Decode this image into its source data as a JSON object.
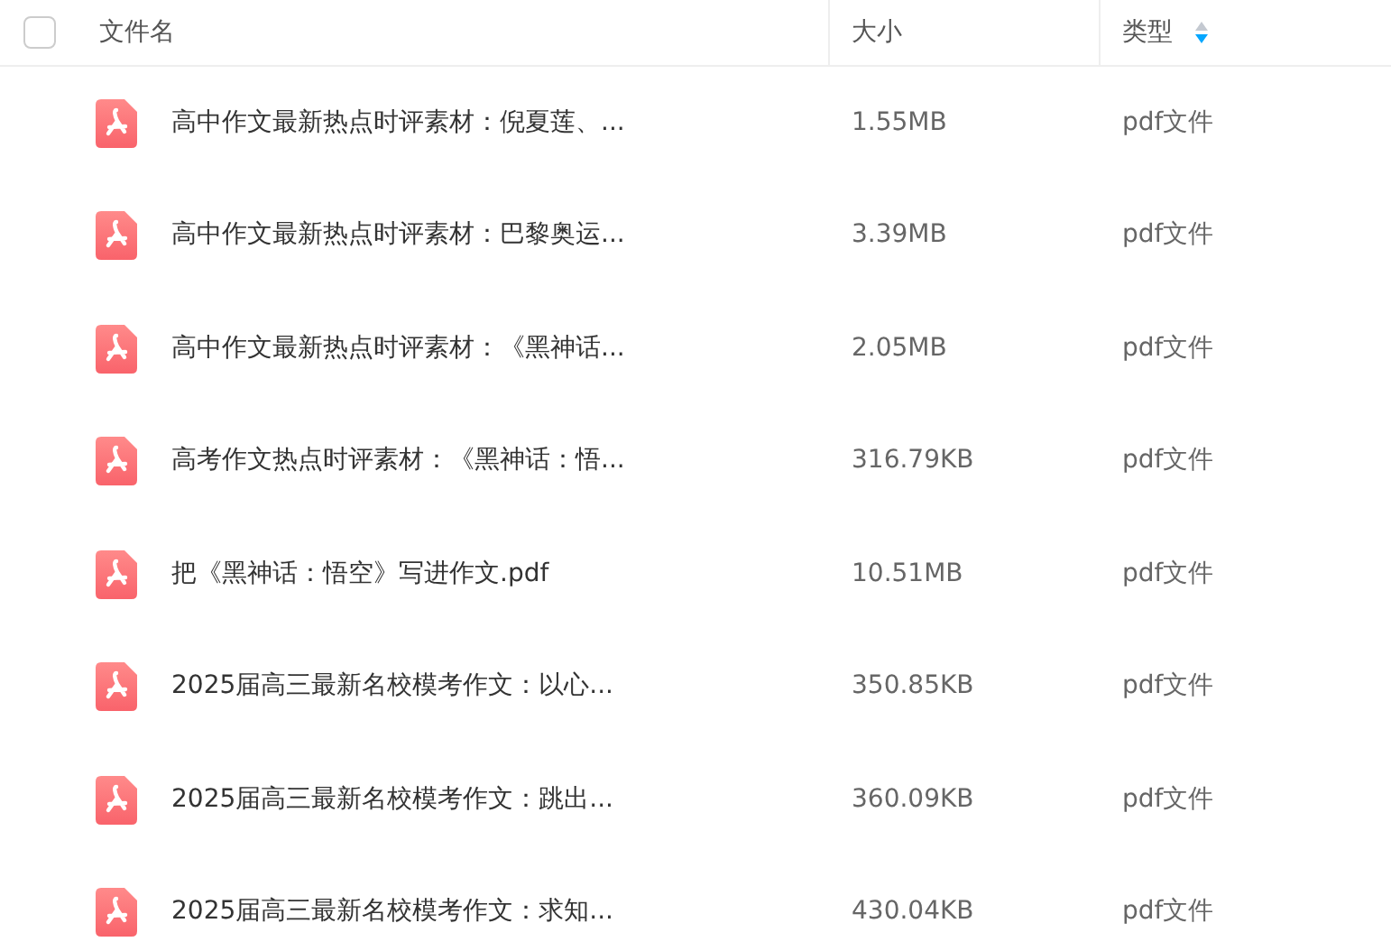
{
  "header": {
    "select_all": {
      "checked": false
    },
    "columns": [
      {
        "label": "文件名"
      },
      {
        "label": "大小"
      },
      {
        "label": "类型",
        "sort_descending": true
      }
    ]
  },
  "files": [
    {
      "name": "高中作文最新热点时评素材：倪夏莲、...",
      "size": "1.55MB",
      "type": "pdf文件"
    },
    {
      "name": "高中作文最新热点时评素材：巴黎奥运...",
      "size": "3.39MB",
      "type": "pdf文件"
    },
    {
      "name": "高中作文最新热点时评素材：《黑神话...",
      "size": "2.05MB",
      "type": "pdf文件"
    },
    {
      "name": "高考作文热点时评素材：《黑神话：悟...",
      "size": "316.79KB",
      "type": "pdf文件"
    },
    {
      "name": "把《黑神话：悟空》写进作文.pdf",
      "size": "10.51MB",
      "type": "pdf文件"
    },
    {
      "name": "2025届高三最新名校模考作文：以心...",
      "size": "350.85KB",
      "type": "pdf文件"
    },
    {
      "name": "2025届高三最新名校模考作文：跳出...",
      "size": "360.09KB",
      "type": "pdf文件"
    },
    {
      "name": "2025届高三最新名校模考作文：求知...",
      "size": "430.04KB",
      "type": "pdf文件"
    }
  ]
}
